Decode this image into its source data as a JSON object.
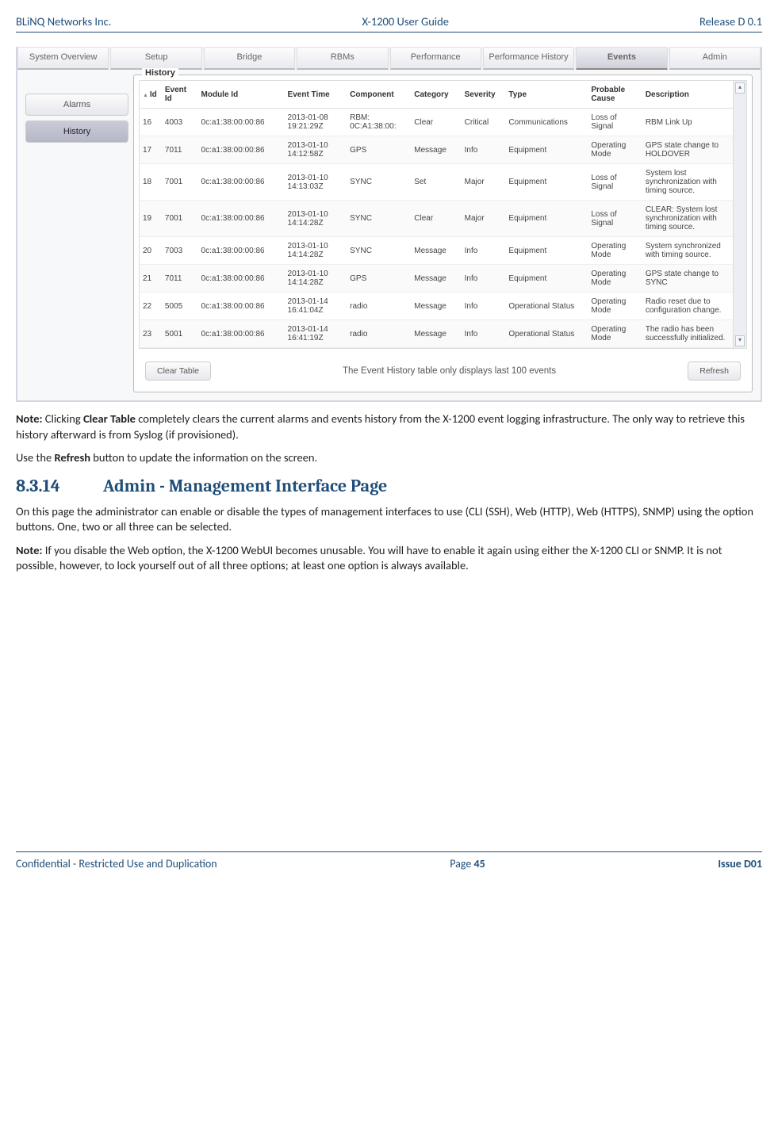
{
  "header": {
    "left": "BLiNQ Networks Inc.",
    "center": "X-1200 User Guide",
    "right": "Release D 0.1"
  },
  "footer": {
    "left": "Confidential - Restricted Use and Duplication",
    "center_prefix": "Page ",
    "center_num": "45",
    "right": "Issue D01"
  },
  "screenshot": {
    "top_tabs": [
      "System Overview",
      "Setup",
      "Bridge",
      "RBMs",
      "Performance",
      "Performance History",
      "Events",
      "Admin"
    ],
    "active_top": "Events",
    "side_tabs": [
      "Alarms",
      "History"
    ],
    "active_side": "History",
    "panel_title": "History",
    "columns": [
      "Id",
      "Event Id",
      "Module Id",
      "Event Time",
      "Component",
      "Category",
      "Severity",
      "Type",
      "Probable Cause",
      "Description"
    ],
    "rows": [
      {
        "id": "16",
        "eid": "4003",
        "mod": "0c:a1:38:00:00:86",
        "time": "2013-01-08 19:21:29Z",
        "comp": "RBM: 0C:A1:38:00:",
        "cat": "Clear",
        "sev": "Critical",
        "type": "Communications",
        "cause": "Loss of Signal",
        "desc": "RBM Link Up"
      },
      {
        "id": "17",
        "eid": "7011",
        "mod": "0c:a1:38:00:00:86",
        "time": "2013-01-10 14:12:58Z",
        "comp": "GPS",
        "cat": "Message",
        "sev": "Info",
        "type": "Equipment",
        "cause": "Operating Mode",
        "desc": "GPS state change to HOLDOVER"
      },
      {
        "id": "18",
        "eid": "7001",
        "mod": "0c:a1:38:00:00:86",
        "time": "2013-01-10 14:13:03Z",
        "comp": "SYNC",
        "cat": "Set",
        "sev": "Major",
        "type": "Equipment",
        "cause": "Loss of Signal",
        "desc": "System lost synchronization with timing source."
      },
      {
        "id": "19",
        "eid": "7001",
        "mod": "0c:a1:38:00:00:86",
        "time": "2013-01-10 14:14:28Z",
        "comp": "SYNC",
        "cat": "Clear",
        "sev": "Major",
        "type": "Equipment",
        "cause": "Loss of Signal",
        "desc": "CLEAR: System lost synchronization with timing source."
      },
      {
        "id": "20",
        "eid": "7003",
        "mod": "0c:a1:38:00:00:86",
        "time": "2013-01-10 14:14:28Z",
        "comp": "SYNC",
        "cat": "Message",
        "sev": "Info",
        "type": "Equipment",
        "cause": "Operating Mode",
        "desc": "System synchronized with timing source."
      },
      {
        "id": "21",
        "eid": "7011",
        "mod": "0c:a1:38:00:00:86",
        "time": "2013-01-10 14:14:28Z",
        "comp": "GPS",
        "cat": "Message",
        "sev": "Info",
        "type": "Equipment",
        "cause": "Operating Mode",
        "desc": "GPS state change to SYNC"
      },
      {
        "id": "22",
        "eid": "5005",
        "mod": "0c:a1:38:00:00:86",
        "time": "2013-01-14 16:41:04Z",
        "comp": "radio",
        "cat": "Message",
        "sev": "Info",
        "type": "Operational Status",
        "cause": "Operating Mode",
        "desc": "Radio reset due to configuration change."
      },
      {
        "id": "23",
        "eid": "5001",
        "mod": "0c:a1:38:00:00:86",
        "time": "2013-01-14 16:41:19Z",
        "comp": "radio",
        "cat": "Message",
        "sev": "Info",
        "type": "Operational Status",
        "cause": "Operating Mode",
        "desc": "The radio has been successfully initialized."
      }
    ],
    "clear_btn": "Clear Table",
    "refresh_btn": "Refresh",
    "footer_msg": "The Event History table only displays last 100 events"
  },
  "para1_a": "Note:",
  "para1_b": " Clicking ",
  "para1_c": "Clear Table",
  "para1_d": " completely clears the current alarms and events history from the X-1200 event logging infrastructure. The only way to retrieve this history afterward is from Syslog (if provisioned).",
  "para2_a": "Use the ",
  "para2_b": "Refresh",
  "para2_c": " button to update the information on the screen.",
  "section_num": "8.3.14",
  "section_title": "Admin - Management Interface Page",
  "para3": "On this page the administrator can enable or disable the types of management interfaces to use (CLI (SSH), Web (HTTP), Web (HTTPS), SNMP) using the option buttons. One, two or all three can be selected.",
  "para4_a": "Note:",
  "para4_b": " If you disable the Web option, the X-1200 WebUI becomes unusable. You will have to enable it again using either the X-1200 CLI or SNMP. It is not possible, however, to lock yourself out of all three options; at least one option is always available."
}
